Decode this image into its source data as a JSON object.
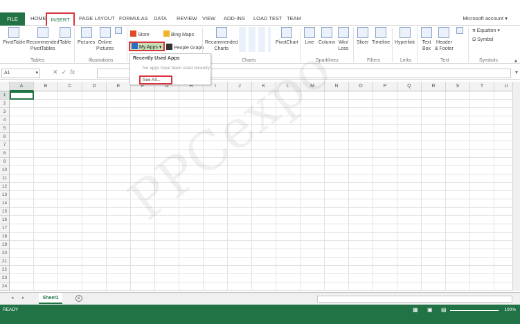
{
  "tabs": {
    "file": "FILE",
    "items": [
      "HOME",
      "INSERT",
      "PAGE LAYOUT",
      "FORMULAS",
      "DATA",
      "REVIEW",
      "VIEW",
      "ADD-INS",
      "LOAD TEST",
      "TEAM"
    ],
    "account": "Microsoft account"
  },
  "ribbon": {
    "tables": {
      "label": "Tables",
      "pivot": "PivotTable",
      "rec_pivot_1": "Recommended",
      "rec_pivot_2": "PivotTables",
      "table": "Table"
    },
    "illustrations": {
      "label": "Illustrations",
      "pictures": "Pictures",
      "online_1": "Online",
      "online_2": "Pictures"
    },
    "apps": {
      "store": "Store",
      "bing": "Bing Maps",
      "myapps": "My Apps",
      "people": "People Graph"
    },
    "charts": {
      "label": "Charts",
      "rec_1": "Recommended",
      "rec_2": "Charts",
      "pivotchart": "PivotChart"
    },
    "sparklines": {
      "label": "Sparklines",
      "line": "Line",
      "column": "Column",
      "winloss_1": "Win/",
      "winloss_2": "Loss"
    },
    "filters": {
      "label": "Filters",
      "slicer": "Slicer",
      "timeline": "Timeline"
    },
    "links": {
      "label": "Links",
      "hyperlink": "Hyperlink"
    },
    "text": {
      "label": "Text",
      "textbox_1": "Text",
      "textbox_2": "Box",
      "hf_1": "Header",
      "hf_2": "& Footer"
    },
    "symbols": {
      "label": "Symbols",
      "equation": "Equation",
      "symbol": "Symbol"
    }
  },
  "dropdown": {
    "title": "Recently Used Apps",
    "empty": "No apps have been used recently",
    "see_all": "See All..."
  },
  "formula": {
    "namebox": "A1",
    "fx": "fx"
  },
  "columns": [
    "A",
    "B",
    "C",
    "D",
    "E",
    "F",
    "G",
    "H",
    "I",
    "J",
    "K",
    "L",
    "M",
    "N",
    "O",
    "P",
    "Q",
    "R",
    "S",
    "T",
    "U"
  ],
  "rows": [
    "1",
    "2",
    "3",
    "4",
    "5",
    "6",
    "7",
    "8",
    "9",
    "10",
    "11",
    "12",
    "13",
    "14",
    "15",
    "16",
    "17",
    "18",
    "19",
    "20",
    "21",
    "22",
    "23",
    "24"
  ],
  "sheet": {
    "name": "Sheet1",
    "add": "+"
  },
  "status": {
    "ready": "READY",
    "zoom": "100%"
  },
  "watermark": "PPCexpo",
  "colors": {
    "accent": "#217346",
    "highlight": "#d9333f"
  }
}
